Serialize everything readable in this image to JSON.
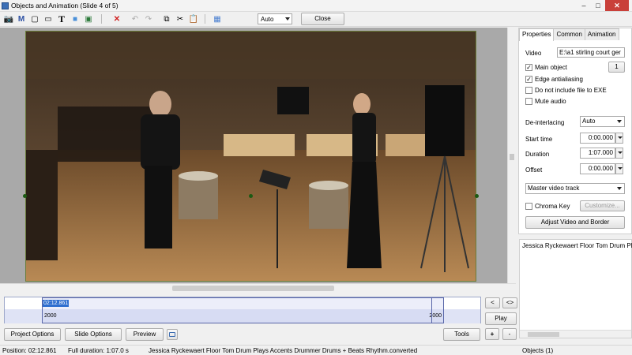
{
  "window": {
    "title": "Objects and Animation (Slide 4 of 5)",
    "controls": {
      "minimize": "–",
      "maximize": "□",
      "close": "✕"
    }
  },
  "toolbar": {
    "tools": [
      {
        "name": "camera-icon",
        "glyph": "📷"
      },
      {
        "name": "mask-icon",
        "glyph": "M"
      },
      {
        "name": "frame-icon",
        "glyph": "▢"
      },
      {
        "name": "button-icon",
        "glyph": "▭"
      },
      {
        "name": "text-icon",
        "glyph": "T"
      },
      {
        "name": "rectangle-icon",
        "glyph": "■"
      },
      {
        "name": "image-icon",
        "glyph": "▣"
      }
    ],
    "delete_glyph": "✕",
    "undo_glyph": "↶",
    "redo_glyph": "↷",
    "copy_glyph": "⧉",
    "cut_glyph": "✂",
    "paste_glyph": "📋",
    "grid_glyph": "▦",
    "zoom_value": "Auto",
    "close_label": "Close"
  },
  "properties": {
    "tabs": [
      "Properties",
      "Common",
      "Animation"
    ],
    "video_label": "Video",
    "video_path": "E:\\a1 stirling court ger",
    "main_object_label": "Main object",
    "main_object_checked": true,
    "main_object_number": "1",
    "edge_antialiasing_label": "Edge antialiasing",
    "edge_antialiasing_checked": true,
    "no_include_label": "Do not include file to EXE",
    "no_include_checked": false,
    "mute_label": "Mute audio",
    "mute_checked": false,
    "deinterlacing_label": "De-interlacing",
    "deinterlacing_value": "Auto",
    "start_time_label": "Start time",
    "start_time_value": "0:00.000",
    "duration_label": "Duration",
    "duration_value": "1:07.000",
    "offset_label": "Offset",
    "offset_value": "0:00.000",
    "master_track_value": "Master video track",
    "chroma_label": "Chroma Key",
    "chroma_checked": false,
    "customize_label": "Customize...",
    "adjust_label": "Adjust Video and Border"
  },
  "objects": {
    "items": [
      "Jessica Ryckewaert Floor Tom Drum Play"
    ]
  },
  "timeline": {
    "position_badge": "02:12.861",
    "left_marker": "2000",
    "right_marker": "2000",
    "prev_label": "<",
    "expand_label": "<>",
    "play_label": "Play"
  },
  "bottom": {
    "project_options": "Project Options",
    "slide_options": "Slide Options",
    "preview": "Preview",
    "tools": "Tools",
    "plus": "+",
    "minus": "-"
  },
  "status": {
    "position": "Position:  02:12.861",
    "full_duration": "Full duration:  1:07.0 s",
    "file": "Jessica Ryckewaert Floor Tom Drum Plays Accents Drummer Drums + Beats Rhythm.converted",
    "objects": "Objects (1)"
  },
  "colors": {
    "accent": "#2e6ecf",
    "close_red": "#c9403a",
    "delete_red": "#d02020",
    "handle_green": "#1b5a13"
  }
}
